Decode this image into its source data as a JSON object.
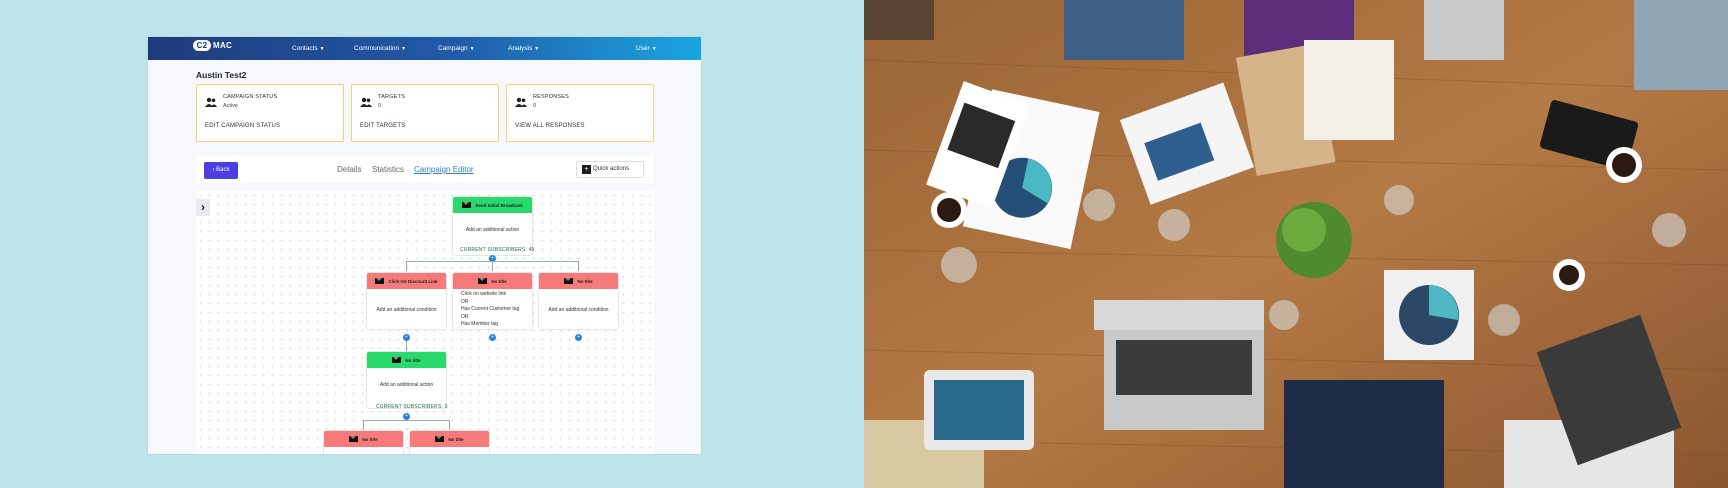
{
  "nav": {
    "logo_mark": "C2",
    "logo_text": "MAC",
    "items": [
      {
        "label": "Contacts"
      },
      {
        "label": "Communication"
      },
      {
        "label": "Campaign"
      },
      {
        "label": "Analysis"
      }
    ],
    "user": "User"
  },
  "page": {
    "title": "Austin Test2",
    "cards": [
      {
        "label": "CAMPAIGN STATUS",
        "value": "Active",
        "action": "EDIT CAMPAIGN STATUS",
        "icon": "users-icon"
      },
      {
        "label": "TARGETS",
        "value": "0",
        "action": "EDIT TARGETS",
        "icon": "users-icon"
      },
      {
        "label": "RESPONSES",
        "value": "0",
        "action": "VIEW ALL RESPONSES",
        "icon": "users-icon"
      }
    ],
    "back_label": "Back",
    "tabs": [
      {
        "label": "Details"
      },
      {
        "label": "Statistics"
      },
      {
        "label": "Campaign Editor"
      }
    ],
    "quick_actions": "Quick actions"
  },
  "flow": {
    "root": {
      "title": "Send Initial Broadcast",
      "body": "Add an additional action",
      "subscribers": "CURRENT SUBSCRIBERS: 45"
    },
    "branches": [
      {
        "title": "Click On Discount Link",
        "body": "Add an additional condition"
      },
      {
        "title": "No title",
        "lines": [
          "Click on website link",
          "OR",
          "Has Current Customer tag",
          "OR",
          "Has Member tag"
        ]
      },
      {
        "title": "No title",
        "body": "Add an additional condition"
      }
    ],
    "second": {
      "title": "No title",
      "body": "Add an additional action",
      "subscribers": "CURRENT SUBSCRIBERS: 0"
    },
    "bottom": [
      {
        "title": "No title"
      },
      {
        "title": "No title"
      }
    ]
  },
  "colors": {
    "accent": "#4b3fe0",
    "card_border": "#f0d27a",
    "node_green": "#29d96b",
    "node_red": "#f77a7a",
    "connector_dot": "#2d7fe0"
  }
}
